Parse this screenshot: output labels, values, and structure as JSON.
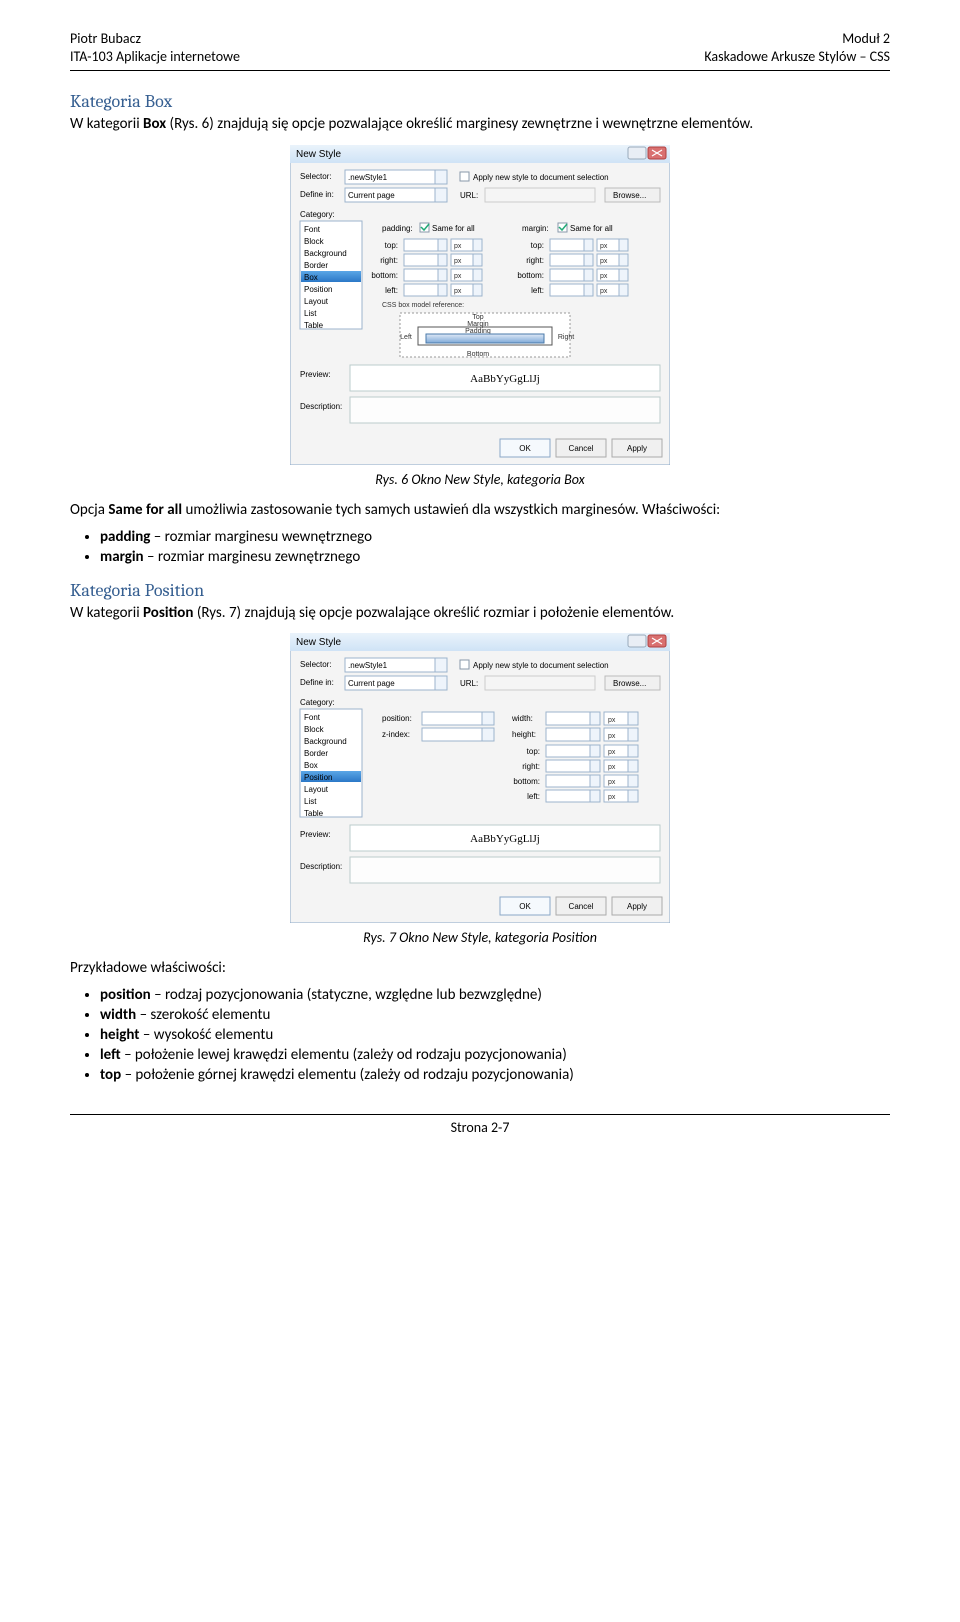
{
  "header": {
    "left1": "Piotr Bubacz",
    "left2": "ITA-103 Aplikacje internetowe",
    "right1": "Moduł 2",
    "right2": "Kaskadowe Arkusze Stylów – CSS"
  },
  "sec1": {
    "title": "Kategoria Box",
    "p1a": "W kategorii ",
    "p1b": "Box",
    "p1c": " (Rys. 6) znajdują się opcje pozwalające określić marginesy zewnętrzne i wewnętrzne elementów."
  },
  "fig1": {
    "caption": "Rys. 6 Okno New Style, kategoria Box",
    "dlg_title": "New Style",
    "selector_lbl": "Selector:",
    "selector_val": ".newStyle1",
    "definein_lbl": "Define in:",
    "definein_val": "Current page",
    "url_lbl": "URL:",
    "apply_chk": "Apply new style to document selection",
    "category_lbl": "Category:",
    "categories": [
      "Font",
      "Block",
      "Background",
      "Border",
      "Box",
      "Position",
      "Layout",
      "List",
      "Table"
    ],
    "selected_cat_idx": 4,
    "padding_lbl": "padding:",
    "margin_lbl": "margin:",
    "sameforall": "Same for all",
    "sides": [
      "top:",
      "right:",
      "bottom:",
      "left:"
    ],
    "unit": "px",
    "boxref": "CSS box model reference:",
    "box_top": "Top",
    "box_left": "Left",
    "box_right": "Right",
    "box_bottom": "Bottom",
    "box_margin": "Margin",
    "box_padding": "Padding",
    "preview_lbl": "Preview:",
    "preview_txt": "AaBbYyGgLlJj",
    "desc_lbl": "Description:",
    "btn_ok": "OK",
    "btn_cancel": "Cancel",
    "btn_apply": "Apply",
    "btn_browse": "Browse..."
  },
  "after1": {
    "p1a": "Opcja ",
    "p1b": "Same for all",
    "p1c": " umożliwia zastosowanie tych samych ustawień dla wszystkich marginesów. Właściwości:",
    "bullets": [
      {
        "b": "padding",
        "t": " – rozmiar marginesu wewnętrznego"
      },
      {
        "b": "margin",
        "t": " – rozmiar marginesu zewnętrznego"
      }
    ]
  },
  "sec2": {
    "title": "Kategoria Position",
    "p1a": "W kategorii ",
    "p1b": "Position",
    "p1c": " (Rys. 7) znajdują się opcje pozwalające określić rozmiar i położenie elementów."
  },
  "fig2": {
    "caption": "Rys. 7 Okno New Style, kategoria Position",
    "selected_cat_idx": 5,
    "position_lbl": "position:",
    "zindex_lbl": "z-index:",
    "width_lbl": "width:",
    "height_lbl": "height:",
    "sides": [
      "top:",
      "right:",
      "bottom:",
      "left:"
    ]
  },
  "after2": {
    "lead": "Przykładowe właściwości:",
    "bullets": [
      {
        "b": "position",
        "t": " – rodzaj pozycjonowania (statyczne, względne lub bezwzględne)"
      },
      {
        "b": "width",
        "t": " – szerokość elementu"
      },
      {
        "b": "height",
        "t": " – wysokość elementu"
      },
      {
        "b": "left",
        "t": " – położenie lewej krawędzi elementu (zależy od rodzaju pozycjonowania)"
      },
      {
        "b": "top",
        "t": " – położenie górnej krawędzi elementu (zależy od rodzaju pozycjonowania)"
      }
    ]
  },
  "footer": "Strona 2-7"
}
